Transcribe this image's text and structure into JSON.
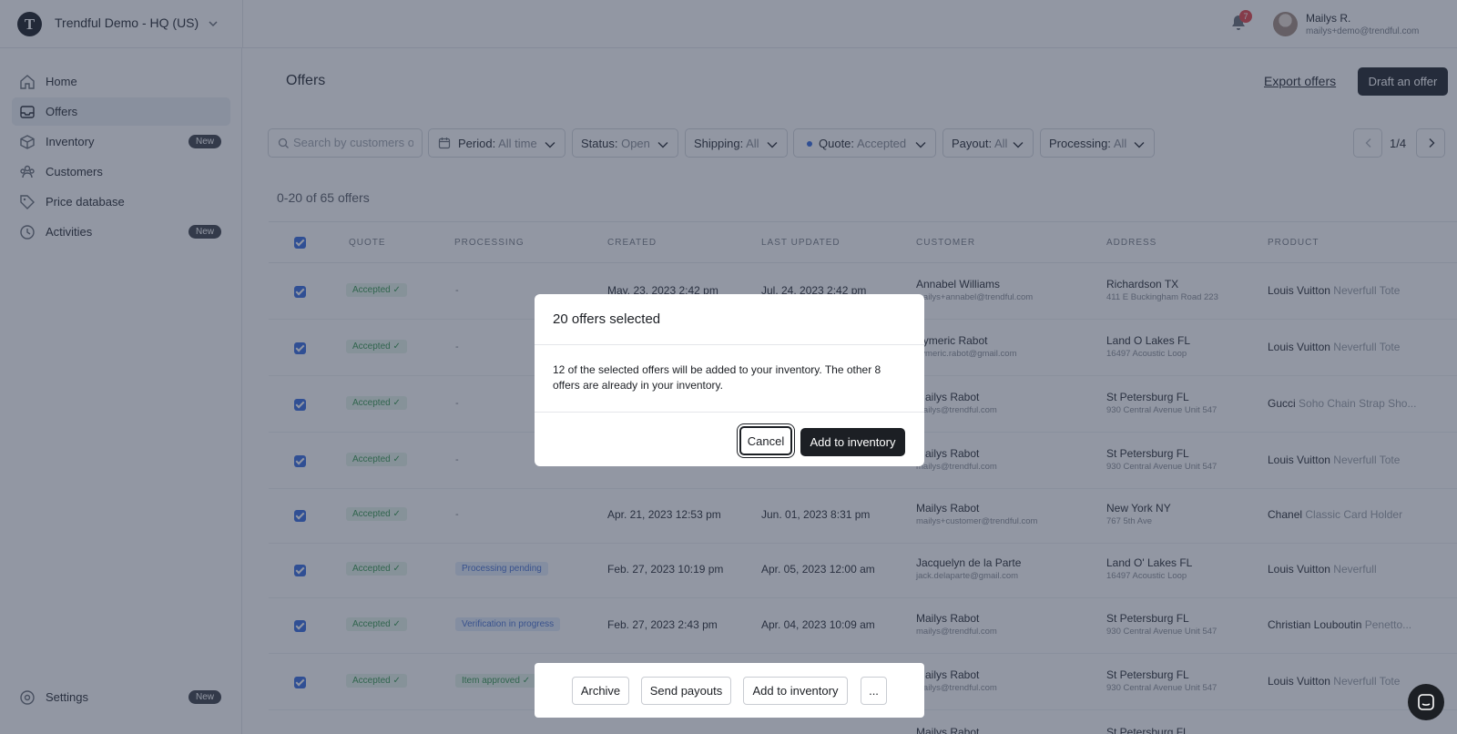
{
  "topbar": {
    "org_logo_letter": "T",
    "org_name": "Trendful Demo - HQ (US)",
    "notification_count": "7",
    "user_name": "Mailys R.",
    "user_email": "mailys+demo@trendful.com"
  },
  "sidebar": {
    "items": [
      {
        "label": "Home",
        "icon": "home-icon"
      },
      {
        "label": "Offers",
        "icon": "inbox-icon"
      },
      {
        "label": "Inventory",
        "icon": "box-icon",
        "badge": "New"
      },
      {
        "label": "Customers",
        "icon": "users-icon"
      },
      {
        "label": "Price database",
        "icon": "tag-icon"
      },
      {
        "label": "Activities",
        "icon": "clock-icon",
        "badge": "New"
      }
    ],
    "settings": {
      "label": "Settings",
      "icon": "settings-icon",
      "badge": "New"
    }
  },
  "header": {
    "title": "Offers",
    "export_label": "Export offers",
    "draft_label": "Draft an offer"
  },
  "filters": {
    "search_placeholder": "Search by customers or",
    "period": {
      "label": "Period:",
      "value": "All time"
    },
    "status": {
      "label": "Status:",
      "value": "Open"
    },
    "shipping": {
      "label": "Shipping:",
      "value": "All"
    },
    "quote": {
      "label": "Quote:",
      "value": "Accepted"
    },
    "payout": {
      "label": "Payout:",
      "value": "All"
    },
    "processing": {
      "label": "Processing:",
      "value": "All"
    }
  },
  "pagination": {
    "text": "1/4"
  },
  "count_text": "0-20 of 65 offers",
  "table": {
    "columns": [
      "QUOTE",
      "PROCESSING",
      "CREATED",
      "LAST UPDATED",
      "CUSTOMER",
      "ADDRESS",
      "PRODUCT"
    ],
    "rows": [
      {
        "quote": "Accepted ✓",
        "processing": "-",
        "created": "May. 23, 2023 2:42 pm",
        "updated": "Jul. 24, 2023 2:42 pm",
        "customer": "Annabel Williams",
        "email": "mailys+annabel@trendful.com",
        "city": "Richardson TX",
        "street": "411 E Buckingham Road 223",
        "brand": "Louis Vuitton",
        "model": "Neverfull Tote"
      },
      {
        "quote": "Accepted ✓",
        "processing": "-",
        "created": "",
        "updated": "",
        "customer": "Aymeric Rabot",
        "email": "aymeric.rabot@gmail.com",
        "city": "Land O Lakes FL",
        "street": "16497 Acoustic Loop",
        "brand": "Louis Vuitton",
        "model": "Neverfull Tote"
      },
      {
        "quote": "Accepted ✓",
        "processing": "-",
        "created": "",
        "updated": "",
        "customer": "Mailys Rabot",
        "email": "mailys@trendful.com",
        "city": "St Petersburg FL",
        "street": "930 Central Avenue Unit 547",
        "brand": "Gucci",
        "model": "Soho Chain Strap Sho..."
      },
      {
        "quote": "Accepted ✓",
        "processing": "-",
        "created": "",
        "updated": "",
        "customer": "Mailys Rabot",
        "email": "mailys@trendful.com",
        "city": "St Petersburg FL",
        "street": "930 Central Avenue Unit 547",
        "brand": "Louis Vuitton",
        "model": "Neverfull Tote"
      },
      {
        "quote": "Accepted ✓",
        "processing": "-",
        "created": "Apr. 21, 2023 12:53 pm",
        "updated": "Jun. 01, 2023 8:31 pm",
        "customer": "Mailys Rabot",
        "email": "mailys+customer@trendful.com",
        "city": "New York NY",
        "street": "767 5th Ave",
        "brand": "Chanel",
        "model": "Classic Card Holder"
      },
      {
        "quote": "Accepted ✓",
        "processing": "Processing pending",
        "created": "Feb. 27, 2023 10:19 pm",
        "updated": "Apr. 05, 2023 12:00 am",
        "customer": "Jacquelyn de la Parte",
        "email": "jack.delaparte@gmail.com",
        "city": "Land O' Lakes FL",
        "street": "16497 Acoustic Loop",
        "brand": "Louis Vuitton",
        "model": "Neverfull"
      },
      {
        "quote": "Accepted ✓",
        "processing": "Verification in progress",
        "created": "Feb. 27, 2023 2:43 pm",
        "updated": "Apr. 04, 2023 10:09 am",
        "customer": "Mailys Rabot",
        "email": "mailys@trendful.com",
        "city": "St Petersburg FL",
        "street": "930 Central Avenue Unit 547",
        "brand": "Christian Louboutin",
        "model": "Penetto..."
      },
      {
        "quote": "Accepted ✓",
        "processing": "Item approved ✓",
        "created": "",
        "updated": "",
        "customer": "Mailys Rabot",
        "email": "mailys@trendful.com",
        "city": "St Petersburg FL",
        "street": "930 Central Avenue Unit 547",
        "brand": "Louis Vuitton",
        "model": "Neverfull Tote"
      },
      {
        "quote": "",
        "processing": "",
        "created": "",
        "updated": "",
        "customer": "Mailys Rabot",
        "email": "",
        "city": "St Petersburg FL",
        "street": "",
        "brand": "",
        "model": ""
      }
    ]
  },
  "action_bar": {
    "archive": "Archive",
    "send_payouts": "Send payouts",
    "add_to_inventory": "Add to inventory",
    "more": "..."
  },
  "modal": {
    "title": "20 offers selected",
    "body": "12 of the selected offers will be added to your inventory. The other 8 offers are already in your inventory.",
    "cancel": "Cancel",
    "confirm": "Add to inventory"
  },
  "colors": {
    "accent": "#3b6fe0",
    "primary_dark": "#1c1f24",
    "success": "#3c9a55",
    "overlay": "#263048"
  }
}
